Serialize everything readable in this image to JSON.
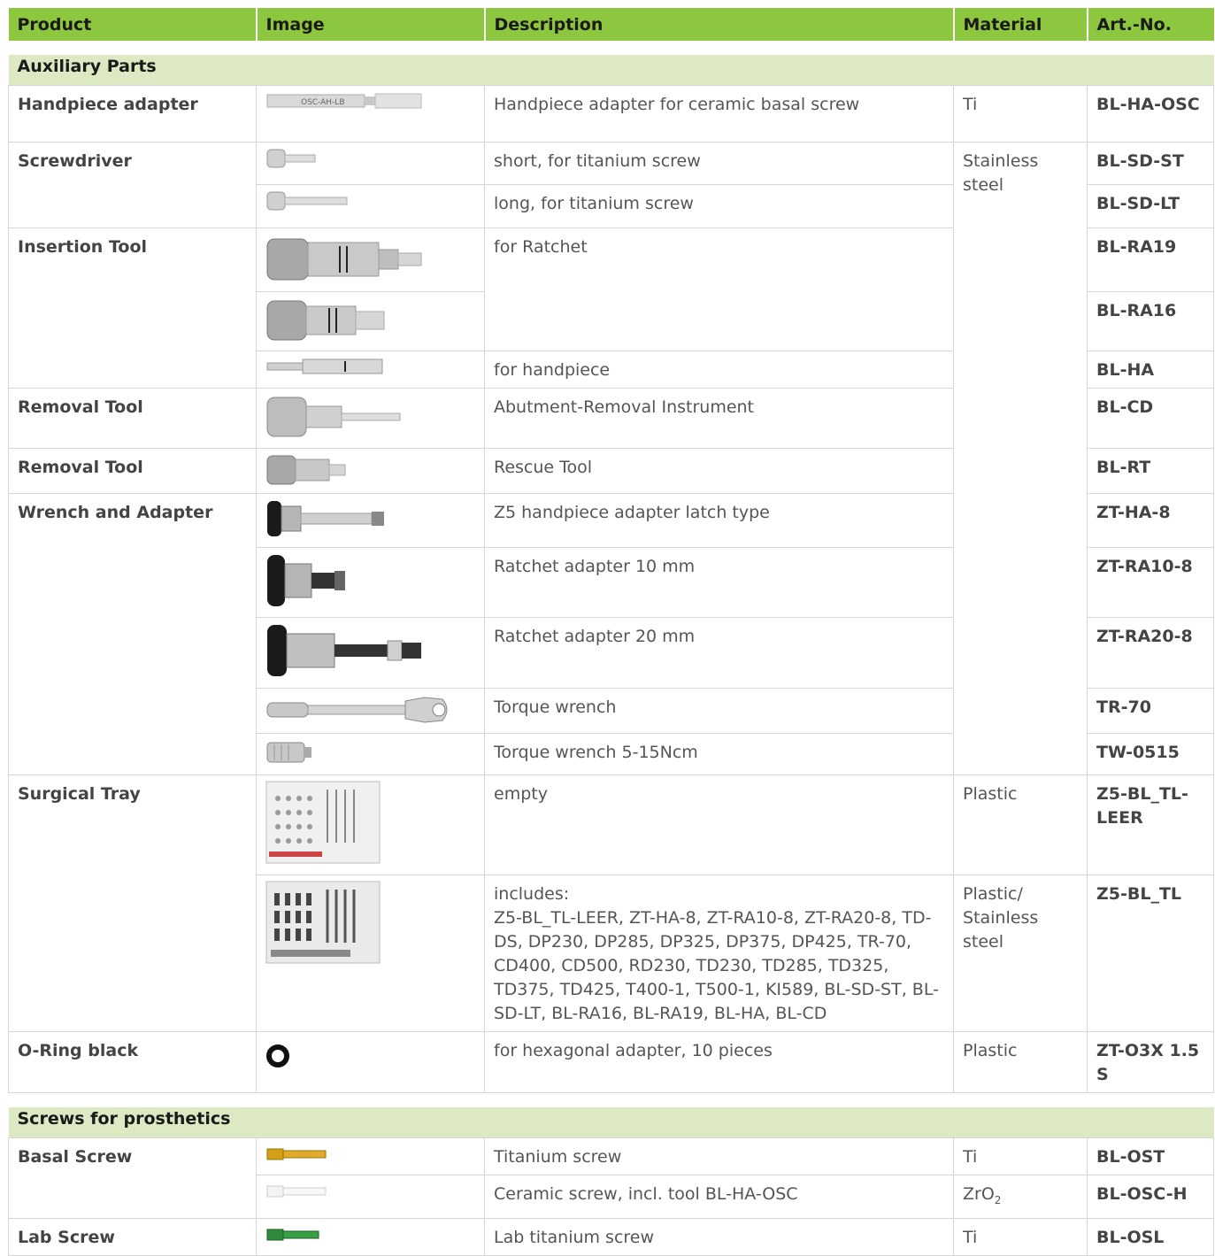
{
  "header": {
    "product": "Product",
    "image": "Image",
    "description": "Description",
    "material": "Material",
    "artno": "Art.-No."
  },
  "sections": [
    {
      "title": "Auxiliary Parts"
    },
    {
      "title": "Screws for prosthetics"
    }
  ],
  "rows": [
    {
      "product": "Handpiece adapter",
      "description": "Handpiece adapter for ceramic basal screw",
      "material": "Ti",
      "artno": "BL-HA-OSC",
      "icon": "handpiece-adapter-icon"
    },
    {
      "product": "Screwdriver",
      "description": "short, for titanium screw",
      "material": "Stainless steel",
      "artno": "BL-SD-ST",
      "icon": "short-screwdriver-icon"
    },
    {
      "product": "",
      "description": "long, for titanium screw",
      "material": "",
      "artno": "BL-SD-LT",
      "icon": "long-screwdriver-icon"
    },
    {
      "product": "Insertion Tool",
      "description": "for Ratchet",
      "material": "",
      "artno": "BL-RA19",
      "icon": "insertion-tool-ra19-icon"
    },
    {
      "product": "",
      "description": "",
      "material": "",
      "artno": "BL-RA16",
      "icon": "insertion-tool-ra16-icon"
    },
    {
      "product": "",
      "description": "for handpiece",
      "material": "",
      "artno": "BL-HA",
      "icon": "insertion-tool-ha-icon"
    },
    {
      "product": "Removal Tool",
      "description": "Abutment-Removal Instrument",
      "material": "",
      "artno": "BL-CD",
      "icon": "abutment-removal-icon"
    },
    {
      "product": "Removal Tool",
      "description": "Rescue Tool",
      "material": "",
      "artno": "BL-RT",
      "icon": "rescue-tool-icon"
    },
    {
      "product": "Wrench and Adapter",
      "description": "Z5 handpiece adapter latch type",
      "material": "",
      "artno": "ZT-HA-8",
      "icon": "latch-adapter-icon"
    },
    {
      "product": "",
      "description": "Ratchet adapter 10 mm",
      "material": "",
      "artno": "ZT-RA10-8",
      "icon": "ratchet-adapter-10-icon"
    },
    {
      "product": "",
      "description": "Ratchet adapter 20 mm",
      "material": "",
      "artno": "ZT-RA20-8",
      "icon": "ratchet-adapter-20-icon"
    },
    {
      "product": "",
      "description": "Torque wrench",
      "material": "",
      "artno": "TR-70",
      "icon": "torque-wrench-icon"
    },
    {
      "product": "",
      "description": "Torque wrench 5-15Ncm",
      "material": "",
      "artno": "TW-0515",
      "icon": "torque-wrench-small-icon"
    },
    {
      "product": "Surgical Tray",
      "description": "empty",
      "material": "Plastic",
      "artno": "Z5-BL_TL-LEER",
      "icon": "empty-tray-icon"
    },
    {
      "product": "",
      "description_lead": "includes:",
      "description": "Z5-BL_TL-LEER, ZT-HA-8, ZT-RA10-8, ZT-RA20-8, TD-DS, DP230, DP285, DP325, DP375, DP425, TR-70, CD400, CD500, RD230, TD230, TD285, TD325, TD375, TD425, T400-1, T500-1, KI589, BL-SD-ST, BL-SD-LT, BL-RA16, BL-RA19, BL-HA, BL-CD",
      "material": "Plastic/ Stainless steel",
      "artno": "Z5-BL_TL",
      "icon": "full-tray-icon"
    },
    {
      "product": "O-Ring black",
      "description": "for hexagonal adapter, 10 pieces",
      "material": "Plastic",
      "artno": "ZT-O3X 1.5 S",
      "icon": "o-ring-icon"
    },
    {
      "product": "Basal Screw",
      "description": "Titanium screw",
      "material": "Ti",
      "artno": "BL-OST",
      "icon": "titanium-screw-icon"
    },
    {
      "product": "",
      "description": "Ceramic screw, incl. tool BL-HA-OSC",
      "material_main": "ZrO",
      "material_sub": "2",
      "artno": "BL-OSC-H",
      "icon": "ceramic-screw-icon"
    },
    {
      "product": "Lab Screw",
      "description": "Lab titanium screw",
      "material": "Ti",
      "artno": "BL-OSL",
      "icon": "lab-screw-icon"
    }
  ]
}
